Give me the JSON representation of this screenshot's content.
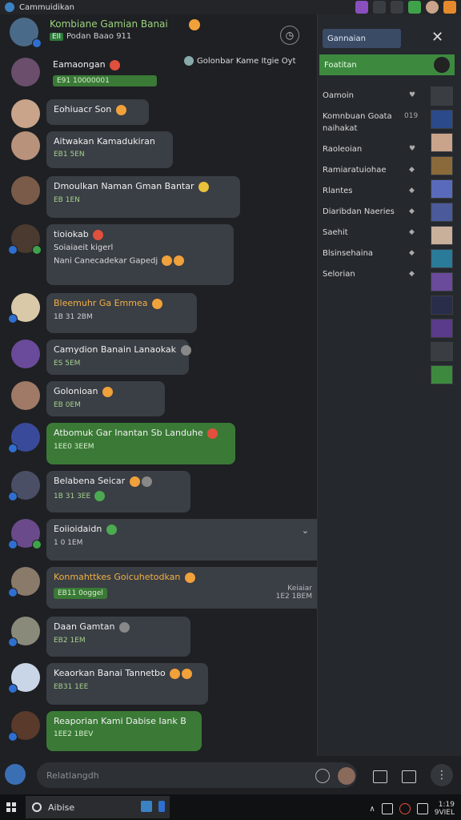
{
  "titlebar": {
    "title": "Cammuidikan"
  },
  "header": {
    "title": "Kombiane Gamian Banai",
    "badge": "EII",
    "subtitle": "Podan Baao 911",
    "action_icon": "clock-icon"
  },
  "pinned": {
    "text": "Golonbar Kame Itgie Oyt"
  },
  "messages": [
    {
      "text": "Eamaongan",
      "time": "E91 10000001",
      "time_chip": true
    },
    {
      "text": "Eohiuacr Son"
    },
    {
      "text": "Aitwakan Kamadukiran",
      "time": "EB1 5EN"
    },
    {
      "text": "Dmoulkan Naman Gman Bantar",
      "time": "EB 1EN"
    },
    {
      "text": "tioiokab",
      "line2": "Soiaiaeit kigerl",
      "line3": "Nani Canecadekar Gapedj"
    },
    {
      "text": "Bleemuhr Ga Emmea",
      "time": "1B 31 2BM",
      "orange": true
    },
    {
      "text": "Camydion Banain Lanaokak",
      "time": "ES 5EM"
    },
    {
      "text": "Golonioan",
      "time": "EB 0EM"
    },
    {
      "text": "Atbomuk Gar Inantan Sb Landuhe",
      "time": "1EE0 3EEM",
      "green": true
    },
    {
      "text": "Belabena Seicar",
      "time": "1B 31 3EE"
    },
    {
      "text": "Eoiioidaidn",
      "time": "1 0 1EM"
    },
    {
      "text": "Konmahttkes Goicuhetodkan",
      "time": "EB11 0oggel",
      "time_chip": true,
      "orange": true,
      "side_label": "Keiaiar",
      "side_time": "1E2 1BEM"
    },
    {
      "text": "Daan Gamtan",
      "time": "EB2 1EM"
    },
    {
      "text": "Keaorkan Banai Tannetbo",
      "time": "EB31 1EE"
    },
    {
      "text": "Reaporian Kami Dabise Iank B",
      "time": "1EE2 1BEV",
      "green": true
    }
  ],
  "sidebar": {
    "search_label": "Gannaian",
    "active_item": "Foatitan",
    "items": [
      {
        "label": "Oamoin"
      },
      {
        "label": "Komnbuan Goata",
        "sub": "naihakat",
        "value": "019"
      },
      {
        "label": "Raoleoian"
      },
      {
        "label": "Ramiaratuiohae"
      },
      {
        "label": "Rlantes"
      },
      {
        "label": "Diaribdan Naeries"
      },
      {
        "label": "Saehit"
      },
      {
        "label": "Blsinsehaina"
      },
      {
        "label": "Selorian"
      }
    ]
  },
  "composer": {
    "placeholder": "Relatlangdh"
  },
  "taskbar": {
    "search_label": "Aibise",
    "time": "1:19",
    "date": "9VIEL"
  },
  "colors": {
    "accent_green": "#3d8a3f",
    "bubble": "#3a3e45",
    "background": "#1e2023"
  }
}
